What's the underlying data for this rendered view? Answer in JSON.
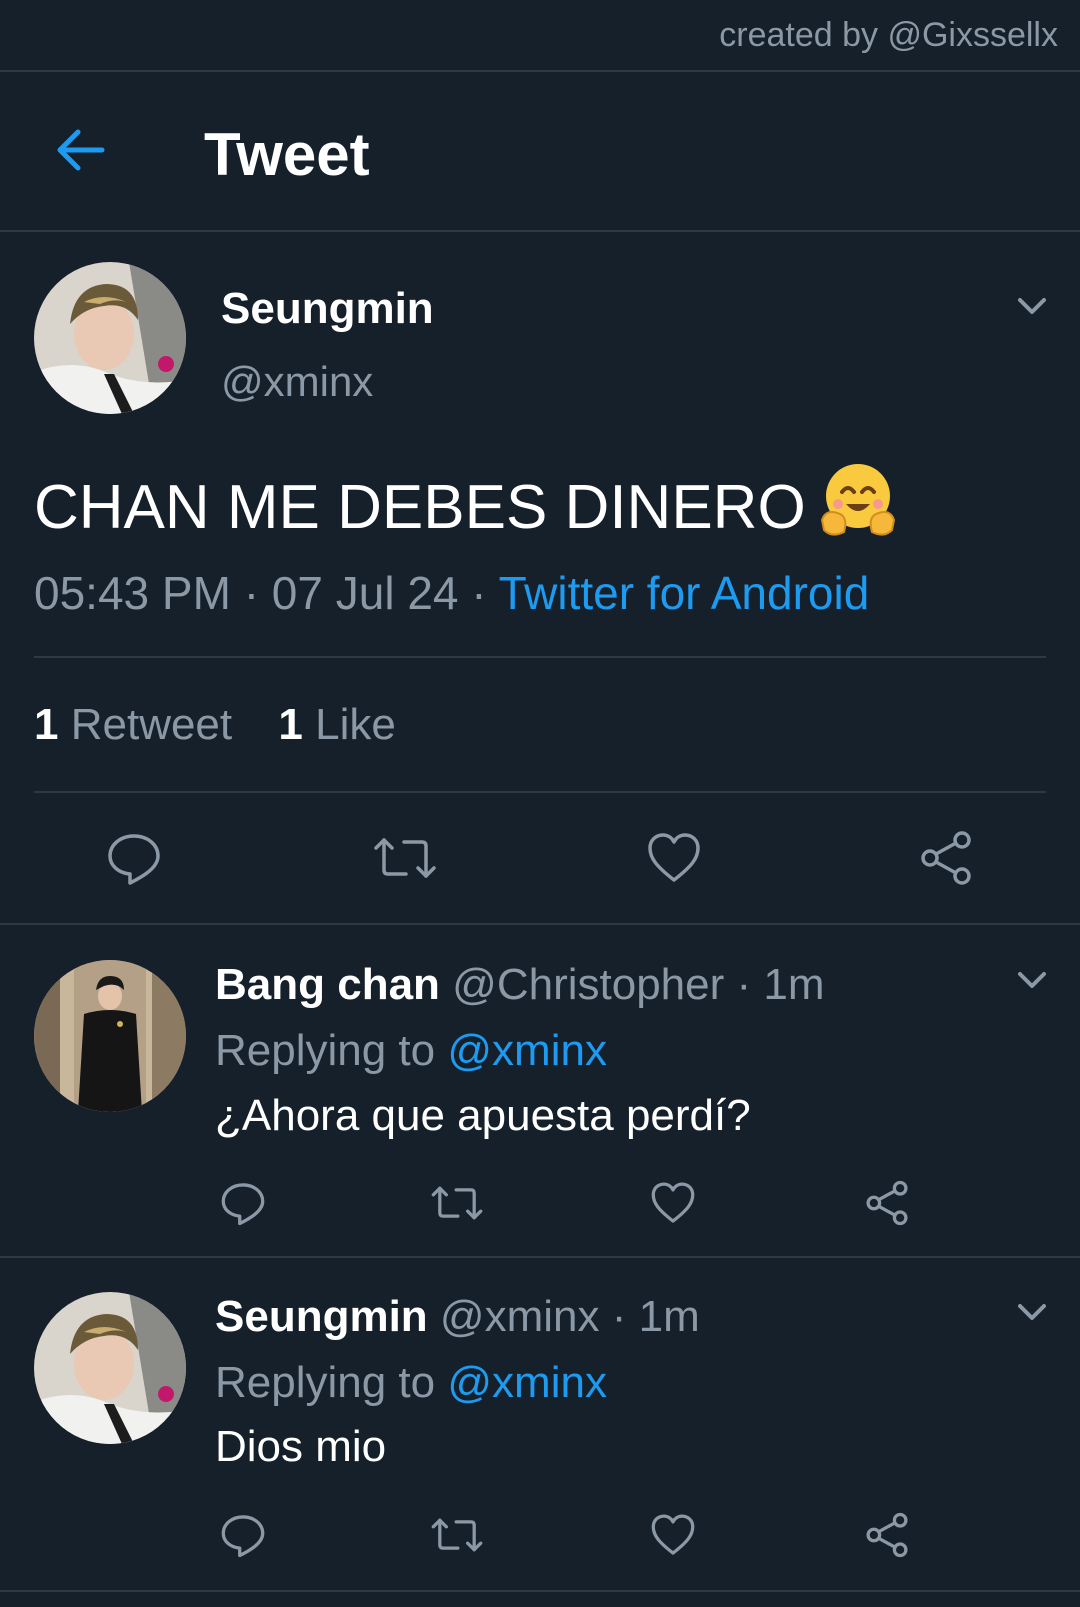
{
  "credit": "created by @Gixssellx",
  "header": {
    "title": "Tweet",
    "back_icon": "arrow-left-icon"
  },
  "tweet": {
    "author_name": "Seungmin",
    "author_handle": "@xminx",
    "text": "CHAN ME DEBES DINERO",
    "emoji_icon": "hugging-face-emoji",
    "time": "05:43 PM",
    "date": "07 Jul 24",
    "separator": "·",
    "source": "Twitter for Android",
    "retweet_count": "1",
    "retweet_label": "Retweet",
    "like_count": "1",
    "like_label": "Like"
  },
  "replies": [
    {
      "name": "Bang chan",
      "handle": "@Christopher",
      "time": "1m",
      "replying_label": "Replying to",
      "replying_to": "@xminx",
      "text": "¿Ahora que apuesta perdí?"
    },
    {
      "name": "Seungmin",
      "handle": "@xminx",
      "time": "1m",
      "replying_label": "Replying to",
      "replying_to": "@xminx",
      "text": "Dios mio"
    }
  ],
  "colors": {
    "background": "#15202b",
    "accent": "#1d9bf0",
    "muted": "#8b98a5",
    "divider": "#2c3a47"
  }
}
